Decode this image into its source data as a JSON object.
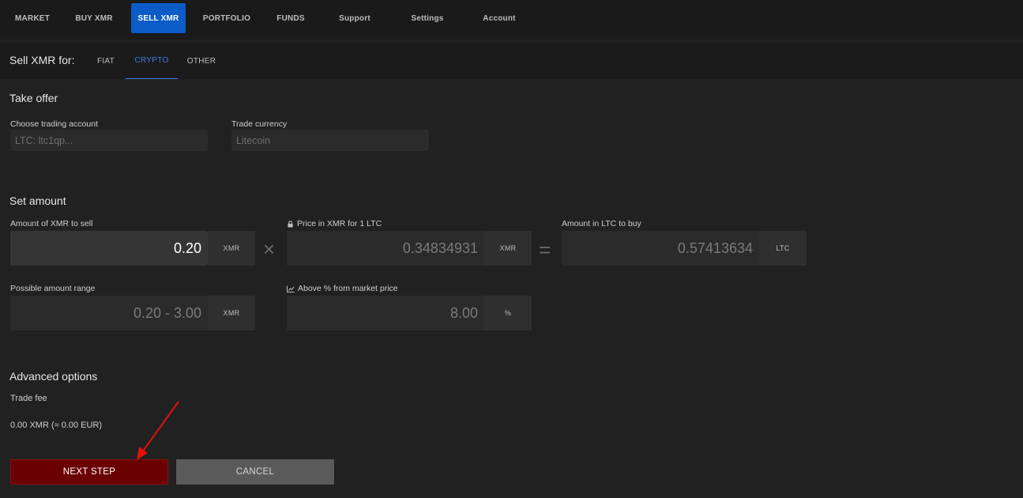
{
  "nav": {
    "items": [
      {
        "label": "MARKET",
        "active": false
      },
      {
        "label": "BUY XMR",
        "active": false
      },
      {
        "label": "SELL XMR",
        "active": true
      },
      {
        "label": "PORTFOLIO",
        "active": false
      },
      {
        "label": "FUNDS",
        "active": false
      },
      {
        "label": "Support",
        "active": false
      },
      {
        "label": "Settings",
        "active": false
      },
      {
        "label": "Account",
        "active": false
      }
    ]
  },
  "subheader": {
    "title": "Sell XMR for:",
    "tabs": [
      {
        "label": "FIAT",
        "active": false
      },
      {
        "label": "CRYPTO",
        "active": true
      },
      {
        "label": "OTHER",
        "active": false
      }
    ]
  },
  "take_offer": {
    "title": "Take offer",
    "account_label": "Choose trading account",
    "account_value": "LTC: ltc1qp...",
    "currency_label": "Trade currency",
    "currency_value": "Litecoin"
  },
  "set_amount": {
    "title": "Set amount",
    "amount_label": "Amount of XMR to sell",
    "amount_value": "0.20",
    "amount_unit": "XMR",
    "multiply_symbol": "×",
    "price_label": "Price in XMR for 1 LTC",
    "price_value": "0.34834931",
    "price_unit": "XMR",
    "equals_symbol": "=",
    "result_label": "Amount in LTC to buy",
    "result_value": "0.57413634",
    "result_unit": "LTC",
    "range_label": "Possible amount range",
    "range_value": "0.20 - 3.00",
    "range_unit": "XMR",
    "above_label": "Above % from market price",
    "above_value": "8.00",
    "above_unit": "%"
  },
  "advanced": {
    "title": "Advanced options",
    "fee_label": "Trade fee",
    "fee_value": "0.00 XMR (≈ 0.00 EUR)"
  },
  "buttons": {
    "next": "NEXT STEP",
    "cancel": "CANCEL"
  },
  "colors": {
    "accent": "#0b5cc6",
    "next_button": "#6b0000",
    "annotation_arrow": "#e01010"
  },
  "icons": {
    "price_lock": "lock-icon",
    "above_market": "chart-line-icon"
  }
}
